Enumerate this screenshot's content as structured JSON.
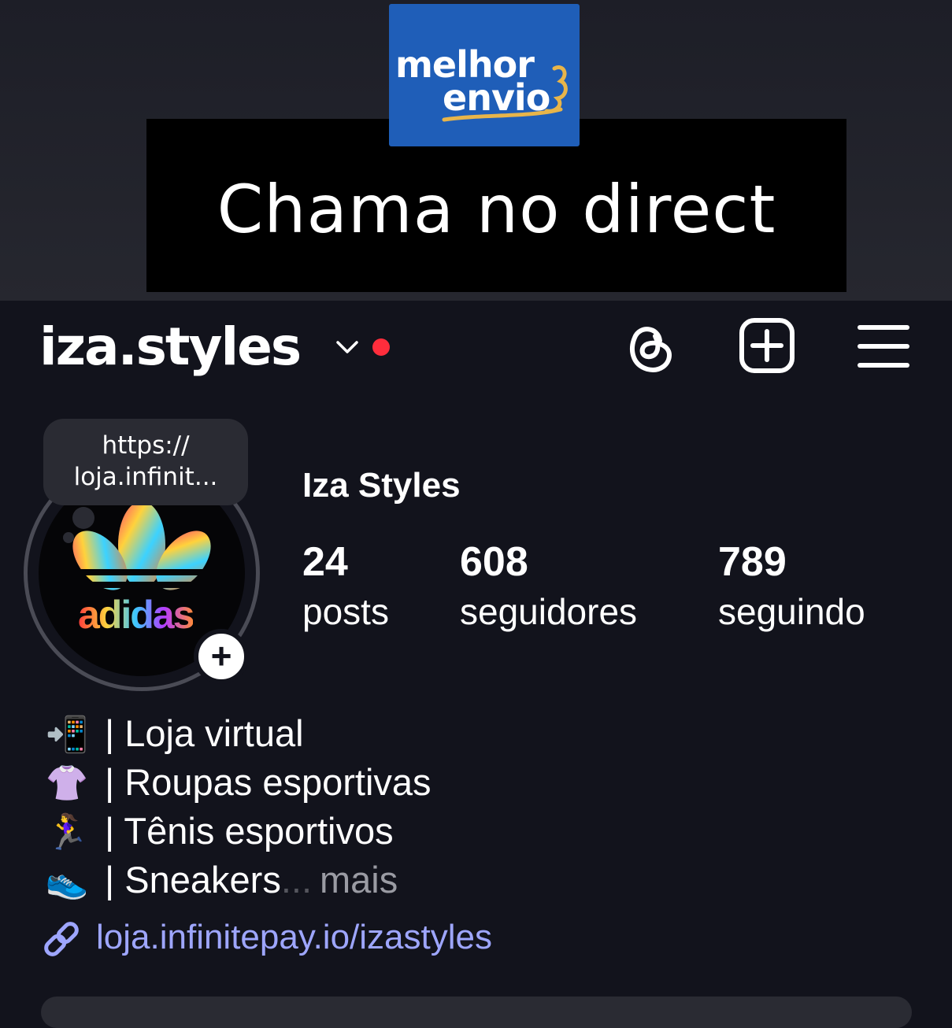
{
  "promo": {
    "logo_line1": "melhor",
    "logo_line2": "envio",
    "logo_color": "#1f5eb8",
    "banner_text": "Chama no direct"
  },
  "header": {
    "username": "iza.styles",
    "icons": [
      "chevron-down-icon",
      "threads-icon",
      "add-post-icon",
      "menu-icon"
    ],
    "live_dot_color": "#ff2d3c"
  },
  "note": {
    "line1": "https://",
    "line2": "loja.infinit..."
  },
  "profile": {
    "display_name": "Iza Styles",
    "stats": [
      {
        "value": "24",
        "label": "posts"
      },
      {
        "value": "608",
        "label": "seguidores"
      },
      {
        "value": "789",
        "label": "seguindo"
      }
    ]
  },
  "bio": {
    "lines": [
      {
        "emoji": "📲",
        "text": "| Loja virtual"
      },
      {
        "emoji": "👚",
        "text": "| Roupas esportivas"
      },
      {
        "emoji": "🏃‍♀️",
        "text": "| Tênis esportivos"
      },
      {
        "emoji": "👟",
        "text": "| Sneakers"
      }
    ],
    "ellipsis": "...",
    "more_label": "mais"
  },
  "link": {
    "url": "loja.infinitepay.io/izastyles",
    "color": "#9ea6ff"
  }
}
